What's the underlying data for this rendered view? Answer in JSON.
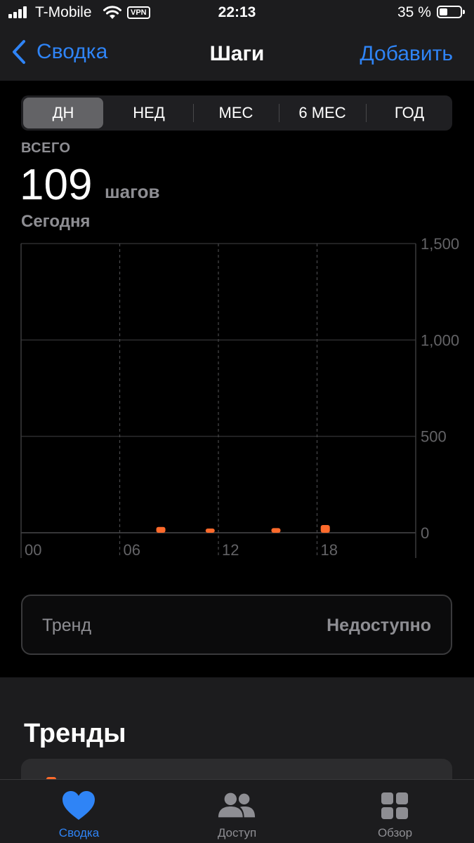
{
  "status_bar": {
    "carrier": "T-Mobile",
    "vpn": "VPN",
    "time": "22:13",
    "battery_percent": "35 %",
    "battery_level": 0.35
  },
  "nav": {
    "back_label": "Сводка",
    "title": "Шаги",
    "add_label": "Добавить"
  },
  "segments": [
    {
      "label": "ДН",
      "selected": true
    },
    {
      "label": "НЕД",
      "selected": false
    },
    {
      "label": "МЕС",
      "selected": false
    },
    {
      "label": "6 МЕС",
      "selected": false
    },
    {
      "label": "ГОД",
      "selected": false
    }
  ],
  "summary": {
    "total_label": "ВСЕГО",
    "total_value": "109",
    "unit": "шагов",
    "date_label": "Сегодня"
  },
  "chart_data": {
    "type": "bar",
    "x_ticks": [
      "00",
      "06",
      "12",
      "18"
    ],
    "y_ticks": [
      "1,500",
      "1,000",
      "500",
      "0"
    ],
    "xlim": [
      0,
      24
    ],
    "ylim": [
      0,
      1500
    ],
    "bars": [
      {
        "hour": 8,
        "value": 30
      },
      {
        "hour": 11,
        "value": 15
      },
      {
        "hour": 15,
        "value": 24
      },
      {
        "hour": 18,
        "value": 40
      }
    ],
    "bar_color": "#ff6a2b"
  },
  "trend": {
    "label": "Тренд",
    "value": "Недоступно"
  },
  "trends_section": {
    "title": "Тренды"
  },
  "tabbar": {
    "items": [
      {
        "label": "Сводка",
        "icon": "heart-icon",
        "active": true
      },
      {
        "label": "Доступ",
        "icon": "people-icon",
        "active": false
      },
      {
        "label": "Обзор",
        "icon": "grid-icon",
        "active": false
      }
    ]
  },
  "colors": {
    "accent": "#2f84f6",
    "inactive": "#8e8e93",
    "bar": "#ff6a2b"
  }
}
